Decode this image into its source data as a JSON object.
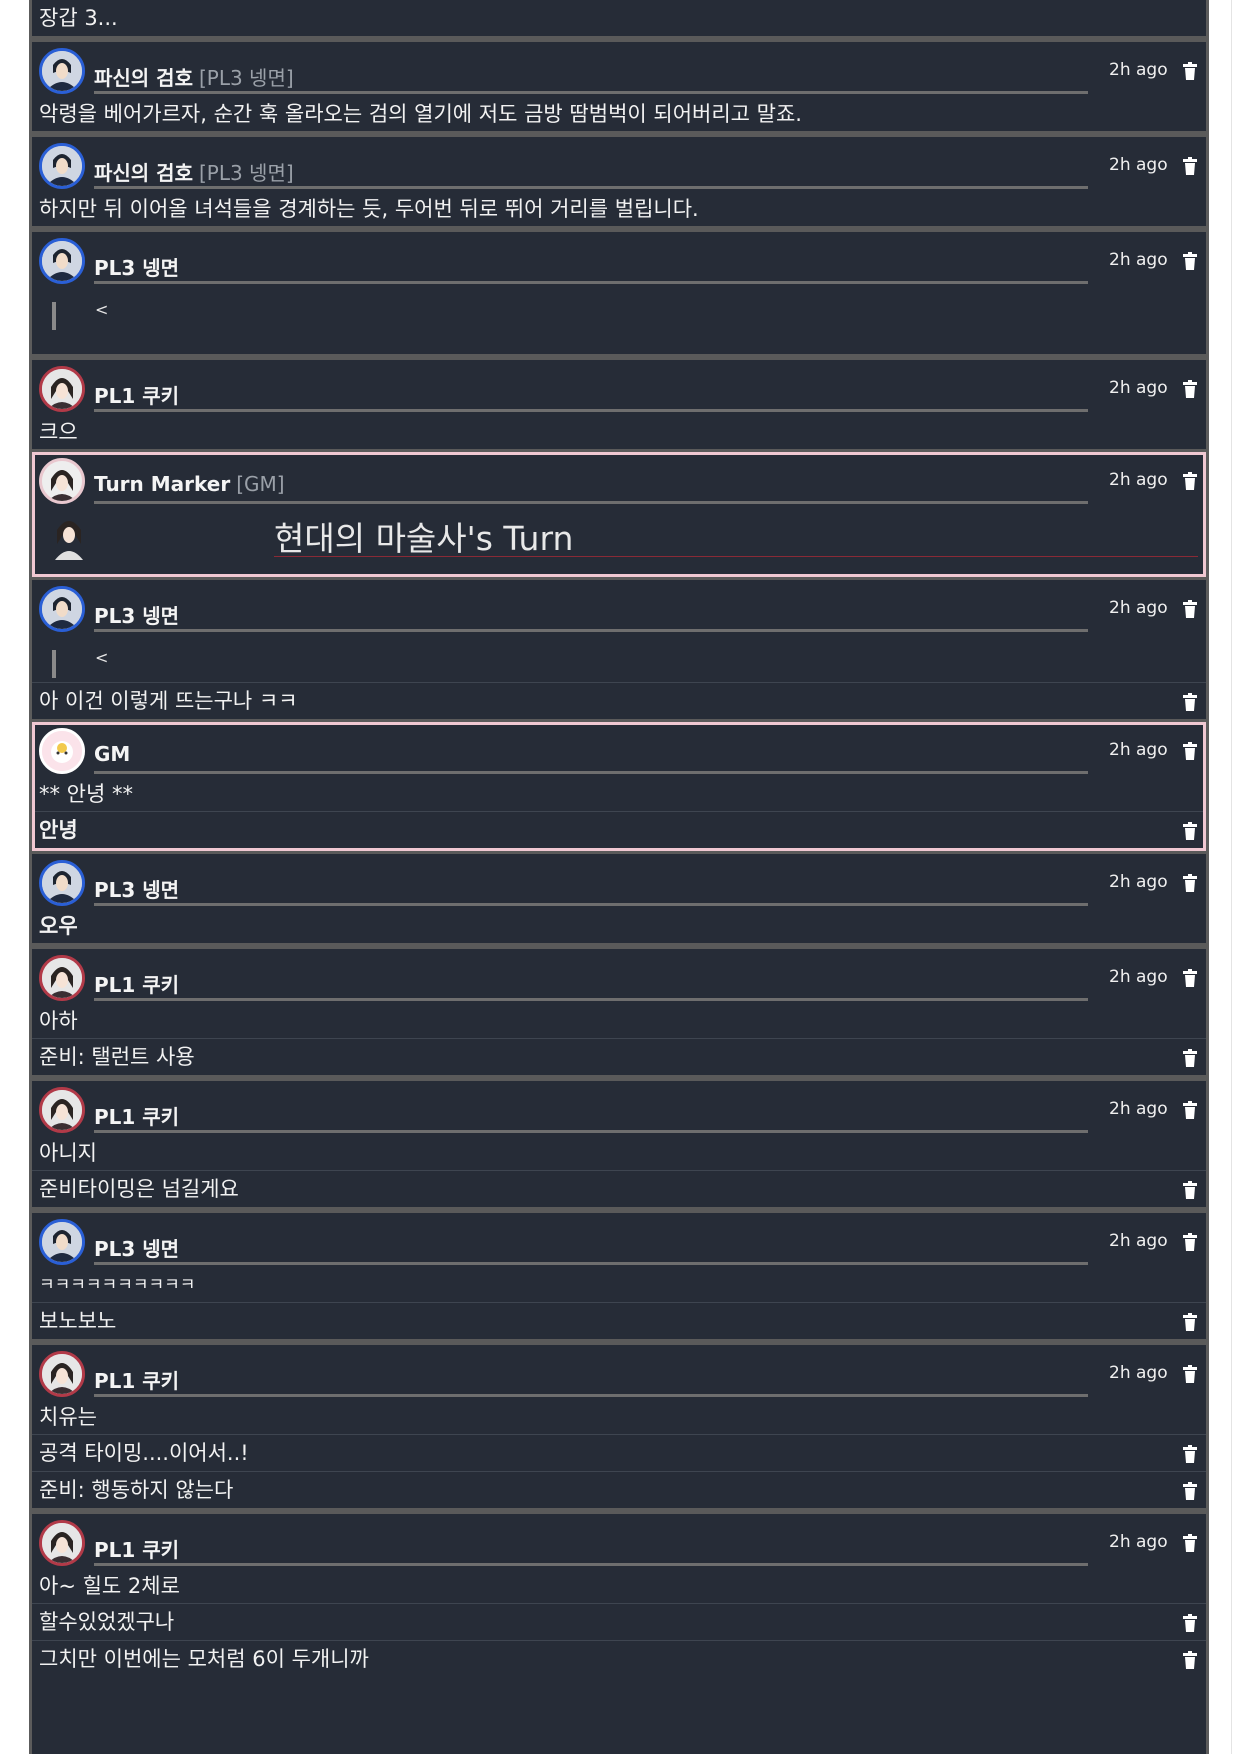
{
  "colors": {
    "panel": "#262c37",
    "separator": "#5a5a5a",
    "pl3_ring": "#2a5fd6",
    "pl1_ring": "#b23a48",
    "gm_border": "#f0c8d2",
    "turn_underline": "#8a2a36"
  },
  "top": {
    "text": "장갑 3..."
  },
  "messages": [
    {
      "name": "파신의 검호",
      "tag": "[PL3 넹면]",
      "time": "2h ago",
      "avatar": "pl3-avatar",
      "lines": [
        "악령을 베어가르자, 순간 훅 올라오는 검의 열기에 저도 금방 땀범벅이 되어버리고 말죠."
      ]
    },
    {
      "name": "파신의 검호",
      "tag": "[PL3 넹면]",
      "time": "2h ago",
      "avatar": "pl3-avatar",
      "lines": [
        "하지만 뒤 이어올 녀석들을 경계하는 듯, 두어번 뒤로 뛰어 거리를 벌립니다."
      ]
    },
    {
      "name": "PL3 넹면",
      "time": "2h ago",
      "avatar": "pl3-avatar",
      "quote": "<"
    },
    {
      "name": "PL1 쿠키",
      "time": "2h ago",
      "avatar": "pl1-avatar",
      "lines": [
        "크으"
      ]
    },
    {
      "name": "Turn Marker",
      "tag": "[GM]",
      "time": "2h ago",
      "avatar": "turn-marker-avatar",
      "turn_text": "현대의 마술사's Turn"
    },
    {
      "name": "PL3 넹면",
      "time": "2h ago",
      "avatar": "pl3-avatar",
      "quote": "<",
      "extra": [
        "아 이건 이렇게 뜨는구나 ㅋㅋ"
      ]
    },
    {
      "name": "GM",
      "time": "2h ago",
      "avatar": "gm-avatar",
      "lines": [
        "** 안녕 **"
      ],
      "extra_bold": [
        "안녕"
      ]
    },
    {
      "name": "PL3 넹면",
      "time": "2h ago",
      "avatar": "pl3-avatar",
      "bold_lines": [
        "오우"
      ]
    },
    {
      "name": "PL1 쿠키",
      "time": "2h ago",
      "avatar": "pl1-avatar",
      "lines": [
        "아하"
      ],
      "extra": [
        "준비: 탤런트 사용"
      ]
    },
    {
      "name": "PL1 쿠키",
      "time": "2h ago",
      "avatar": "pl1-avatar",
      "lines": [
        "아니지"
      ],
      "extra": [
        "준비타이밍은 넘길게요"
      ]
    },
    {
      "name": "PL3 넹면",
      "time": "2h ago",
      "avatar": "pl3-avatar",
      "lines": [
        "ㅋㅋㅋㅋㅋㅋㅋㅋㅋㅋ"
      ],
      "extra": [
        "보노보노"
      ]
    },
    {
      "name": "PL1 쿠키",
      "time": "2h ago",
      "avatar": "pl1-avatar",
      "lines": [
        "치유는"
      ],
      "extra": [
        "공격 타이밍....이어서..!",
        "준비: 행동하지 않는다"
      ]
    },
    {
      "name": "PL1 쿠키",
      "time": "2h ago",
      "avatar": "pl1-avatar",
      "lines": [
        "아~ 힐도 2체로"
      ],
      "extra": [
        "할수있었겠구나",
        "그치만 이번에는 모처럼 6이 두개니까"
      ]
    }
  ]
}
